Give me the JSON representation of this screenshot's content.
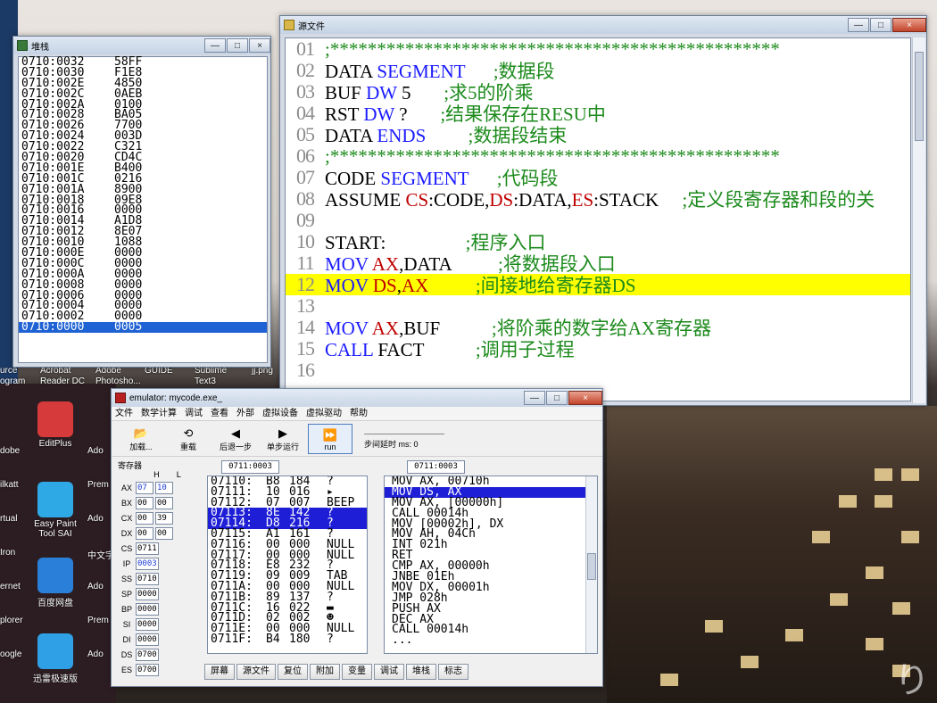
{
  "desktop": {
    "top_icon_labels": [
      "urce",
      "Acrobat",
      "Adobe",
      "GUIDE",
      "Sublime",
      "jj.png"
    ],
    "top_icon_labels2": [
      "ogram",
      "Reader DC",
      "Photosho...",
      "",
      "Text3",
      ""
    ],
    "left_icons": [
      {
        "label": "EditPlus",
        "sub": ""
      },
      {
        "label": "Easy Paint",
        "sub": "Tool SAI"
      },
      {
        "label": "百度网盘",
        "sub": ""
      },
      {
        "label": "迅雷极速版",
        "sub": ""
      }
    ],
    "left_labels": [
      "dobe",
      "ilkatt",
      "rtual",
      "Iron",
      "ernet",
      "plorer",
      "oogle"
    ],
    "mid_labels": [
      "Ado",
      "Prem",
      "Ado",
      "中文字",
      "Ado",
      "Prem",
      "Ado"
    ],
    "corner_mark": "り"
  },
  "stack_window": {
    "title": "堆栈",
    "rows": [
      {
        "addr": "0710:0032",
        "val": "58FF"
      },
      {
        "addr": "0710:0030",
        "val": "F1E8"
      },
      {
        "addr": "0710:002E",
        "val": "4850"
      },
      {
        "addr": "0710:002C",
        "val": "0AEB"
      },
      {
        "addr": "0710:002A",
        "val": "0100"
      },
      {
        "addr": "0710:0028",
        "val": "BA05"
      },
      {
        "addr": "0710:0026",
        "val": "7700"
      },
      {
        "addr": "0710:0024",
        "val": "003D"
      },
      {
        "addr": "0710:0022",
        "val": "C321"
      },
      {
        "addr": "0710:0020",
        "val": "CD4C"
      },
      {
        "addr": "0710:001E",
        "val": "B400"
      },
      {
        "addr": "0710:001C",
        "val": "0216"
      },
      {
        "addr": "0710:001A",
        "val": "8900"
      },
      {
        "addr": "0710:0018",
        "val": "09E8"
      },
      {
        "addr": "0710:0016",
        "val": "0000"
      },
      {
        "addr": "0710:0014",
        "val": "A1D8"
      },
      {
        "addr": "0710:0012",
        "val": "8E07"
      },
      {
        "addr": "0710:0010",
        "val": "1088"
      },
      {
        "addr": "0710:000E",
        "val": "0000"
      },
      {
        "addr": "0710:000C",
        "val": "0000"
      },
      {
        "addr": "0710:000A",
        "val": "0000"
      },
      {
        "addr": "0710:0008",
        "val": "0000"
      },
      {
        "addr": "0710:0006",
        "val": "0000"
      },
      {
        "addr": "0710:0004",
        "val": "0000"
      },
      {
        "addr": "0710:0002",
        "val": "0000"
      },
      {
        "addr": "0710:0000",
        "val": "0005 <",
        "selected": true
      }
    ]
  },
  "source_window": {
    "title": "源文件",
    "lines": [
      {
        "n": "01",
        "parts": [
          {
            "t": ";************************************************",
            "c": "cm"
          }
        ]
      },
      {
        "n": "02",
        "parts": [
          {
            "t": "DATA ",
            "c": "code"
          },
          {
            "t": "SEGMENT",
            "c": "kw"
          },
          {
            "t": "      ;数据段",
            "c": "cm"
          }
        ]
      },
      {
        "n": "03",
        "parts": [
          {
            "t": "BUF ",
            "c": "code"
          },
          {
            "t": "DW",
            "c": "kw"
          },
          {
            "t": " 5       ",
            "c": "code"
          },
          {
            "t": ";求5的阶乘",
            "c": "cm"
          }
        ]
      },
      {
        "n": "04",
        "parts": [
          {
            "t": "RST ",
            "c": "code"
          },
          {
            "t": "DW",
            "c": "kw"
          },
          {
            "t": " ?       ",
            "c": "code"
          },
          {
            "t": ";结果保存在RESU中",
            "c": "cm"
          }
        ]
      },
      {
        "n": "05",
        "parts": [
          {
            "t": "DATA ",
            "c": "code"
          },
          {
            "t": "ENDS",
            "c": "kw"
          },
          {
            "t": "         ;数据段结束",
            "c": "cm"
          }
        ]
      },
      {
        "n": "06",
        "parts": [
          {
            "t": ";************************************************",
            "c": "cm"
          }
        ]
      },
      {
        "n": "07",
        "parts": [
          {
            "t": "CODE ",
            "c": "code"
          },
          {
            "t": "SEGMENT",
            "c": "kw"
          },
          {
            "t": "      ;代码段",
            "c": "cm"
          }
        ]
      },
      {
        "n": "08",
        "parts": [
          {
            "t": "ASSUME ",
            "c": "code"
          },
          {
            "t": "CS",
            "c": "reg"
          },
          {
            "t": ":CODE,",
            "c": "code"
          },
          {
            "t": "DS",
            "c": "reg"
          },
          {
            "t": ":DATA,",
            "c": "code"
          },
          {
            "t": "ES",
            "c": "reg"
          },
          {
            "t": ":STACK     ",
            "c": "code"
          },
          {
            "t": ";定义段寄存器和段的关",
            "c": "cm"
          }
        ]
      },
      {
        "n": "09",
        "parts": []
      },
      {
        "n": "10",
        "parts": [
          {
            "t": "START:                 ",
            "c": "code"
          },
          {
            "t": ";程序入口",
            "c": "cm"
          }
        ]
      },
      {
        "n": "11",
        "parts": [
          {
            "t": "MOV ",
            "c": "kw"
          },
          {
            "t": "AX",
            "c": "reg"
          },
          {
            "t": ",DATA          ",
            "c": "code"
          },
          {
            "t": ";将数据段入口",
            "c": "cm"
          }
        ]
      },
      {
        "n": "12",
        "parts": [
          {
            "t": "MOV ",
            "c": "kw"
          },
          {
            "t": "DS",
            "c": "reg"
          },
          {
            "t": ",",
            "c": "code"
          },
          {
            "t": "AX",
            "c": "reg"
          },
          {
            "t": "          ",
            "c": "code"
          },
          {
            "t": ";间接地给寄存器DS",
            "c": "cm"
          }
        ],
        "highlight": true
      },
      {
        "n": "13",
        "parts": []
      },
      {
        "n": "14",
        "parts": [
          {
            "t": "MOV ",
            "c": "kw"
          },
          {
            "t": "AX",
            "c": "reg"
          },
          {
            "t": ",BUF           ",
            "c": "code"
          },
          {
            "t": ";将阶乘的数字给AX寄存器",
            "c": "cm"
          }
        ]
      },
      {
        "n": "15",
        "parts": [
          {
            "t": "CALL ",
            "c": "kw"
          },
          {
            "t": "FACT           ",
            "c": "code"
          },
          {
            "t": ";调用子过程",
            "c": "cm"
          }
        ]
      },
      {
        "n": "16",
        "parts": []
      }
    ]
  },
  "emulator": {
    "title": "emulator: mycode.exe_",
    "menu": [
      "文件",
      "数学计算",
      "调试",
      "查看",
      "外部",
      "虚拟设备",
      "虚拟驱动",
      "帮助"
    ],
    "toolbar": [
      {
        "label": "加载...",
        "icon": "load-icon",
        "glyph": "📂"
      },
      {
        "label": "重载",
        "icon": "reload-icon",
        "glyph": "⟲"
      },
      {
        "label": "后退一步",
        "icon": "step-back-icon",
        "glyph": "◀"
      },
      {
        "label": "单步运行",
        "icon": "step-forward-icon",
        "glyph": "▶"
      },
      {
        "label": "run",
        "icon": "run-icon",
        "glyph": "⏩"
      }
    ],
    "speed_label": "步间延时 ms: 0",
    "registers_title": "寄存器",
    "hl_header": "H L",
    "registers": [
      {
        "name": "AX",
        "h": "07",
        "l": "10",
        "blue": true
      },
      {
        "name": "BX",
        "h": "00",
        "l": "00"
      },
      {
        "name": "CX",
        "h": "00",
        "l": "39"
      },
      {
        "name": "DX",
        "h": "00",
        "l": "00"
      },
      {
        "name": "CS",
        "v": "0711"
      },
      {
        "name": "IP",
        "v": "0003",
        "blue": true
      },
      {
        "name": "SS",
        "v": "0710"
      },
      {
        "name": "SP",
        "v": "0000"
      },
      {
        "name": "BP",
        "v": "0000"
      },
      {
        "name": "SI",
        "v": "0000"
      },
      {
        "name": "DI",
        "v": "0000"
      },
      {
        "name": "DS",
        "v": "0700"
      },
      {
        "name": "ES",
        "v": "0700"
      }
    ],
    "mem_addr": "0711:0003",
    "dis_addr": "0711:0003",
    "memory": [
      {
        "a": "07110:",
        "b": "B8",
        "d": "184",
        "c": "?"
      },
      {
        "a": "07111:",
        "b": "10",
        "d": "016",
        "c": "▸"
      },
      {
        "a": "07112:",
        "b": "07",
        "d": "007",
        "c": "BEEP"
      },
      {
        "a": "07113:",
        "b": "8E",
        "d": "142",
        "c": "?",
        "sel": true
      },
      {
        "a": "07114:",
        "b": "D8",
        "d": "216",
        "c": "?",
        "sel": true
      },
      {
        "a": "07115:",
        "b": "A1",
        "d": "161",
        "c": "?"
      },
      {
        "a": "07116:",
        "b": "00",
        "d": "000",
        "c": "NULL"
      },
      {
        "a": "07117:",
        "b": "00",
        "d": "000",
        "c": "NULL"
      },
      {
        "a": "07118:",
        "b": "E8",
        "d": "232",
        "c": "?"
      },
      {
        "a": "07119:",
        "b": "09",
        "d": "009",
        "c": "TAB"
      },
      {
        "a": "0711A:",
        "b": "00",
        "d": "000",
        "c": "NULL"
      },
      {
        "a": "0711B:",
        "b": "89",
        "d": "137",
        "c": "?"
      },
      {
        "a": "0711C:",
        "b": "16",
        "d": "022",
        "c": "▬"
      },
      {
        "a": "0711D:",
        "b": "02",
        "d": "002",
        "c": "☻"
      },
      {
        "a": "0711E:",
        "b": "00",
        "d": "000",
        "c": "NULL"
      },
      {
        "a": "0711F:",
        "b": "B4",
        "d": "180",
        "c": "?"
      }
    ],
    "disasm": [
      {
        "t": "MOV AX, 00710h"
      },
      {
        "t": "MOV DS, AX",
        "sel": true
      },
      {
        "t": "MOV AX, [00000h]"
      },
      {
        "t": "CALL 00014h"
      },
      {
        "t": "MOV [00002h], DX"
      },
      {
        "t": "MOV AH, 04Ch"
      },
      {
        "t": "INT 021h"
      },
      {
        "t": "RET"
      },
      {
        "t": "CMP AX, 00000h"
      },
      {
        "t": "JNBE 01Eh"
      },
      {
        "t": "MOV DX, 00001h"
      },
      {
        "t": "JMP 028h"
      },
      {
        "t": "PUSH AX"
      },
      {
        "t": "DEC AX"
      },
      {
        "t": "CALL 00014h"
      },
      {
        "t": "..."
      }
    ],
    "bottom_buttons": [
      "屏幕",
      "源文件",
      "复位",
      "附加",
      "变量",
      "调试",
      "堆栈",
      "标志"
    ]
  }
}
